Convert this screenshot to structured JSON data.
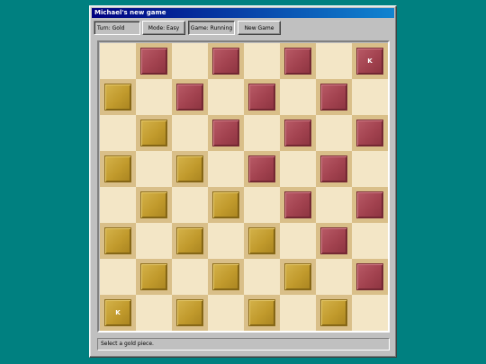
{
  "window": {
    "title": "Michael's new game"
  },
  "toolbar": {
    "turn": "Turn: Gold",
    "mode": "Mode: Easy",
    "game": "Game: Running",
    "new_game": "New Game"
  },
  "board": {
    "rows": 8,
    "cols": 8,
    "colors": {
      "light": "#f3e6c6",
      "dark": "#d9bf89",
      "red": "#a2424f",
      "gold": "#c19a2c"
    },
    "pieces": [
      {
        "row": 0,
        "col": 1,
        "color": "red",
        "king": false
      },
      {
        "row": 0,
        "col": 3,
        "color": "red",
        "king": false
      },
      {
        "row": 0,
        "col": 5,
        "color": "red",
        "king": false
      },
      {
        "row": 0,
        "col": 7,
        "color": "red",
        "king": true
      },
      {
        "row": 1,
        "col": 0,
        "color": "gold",
        "king": false
      },
      {
        "row": 1,
        "col": 2,
        "color": "red",
        "king": false
      },
      {
        "row": 1,
        "col": 4,
        "color": "red",
        "king": false
      },
      {
        "row": 1,
        "col": 6,
        "color": "red",
        "king": false
      },
      {
        "row": 2,
        "col": 1,
        "color": "gold",
        "king": false
      },
      {
        "row": 2,
        "col": 3,
        "color": "red",
        "king": false
      },
      {
        "row": 2,
        "col": 5,
        "color": "red",
        "king": false
      },
      {
        "row": 2,
        "col": 7,
        "color": "red",
        "king": false
      },
      {
        "row": 3,
        "col": 0,
        "color": "gold",
        "king": false
      },
      {
        "row": 3,
        "col": 2,
        "color": "gold",
        "king": false
      },
      {
        "row": 3,
        "col": 4,
        "color": "red",
        "king": false
      },
      {
        "row": 3,
        "col": 6,
        "color": "red",
        "king": false
      },
      {
        "row": 4,
        "col": 1,
        "color": "gold",
        "king": false
      },
      {
        "row": 4,
        "col": 3,
        "color": "gold",
        "king": false
      },
      {
        "row": 4,
        "col": 5,
        "color": "red",
        "king": false
      },
      {
        "row": 4,
        "col": 7,
        "color": "red",
        "king": false
      },
      {
        "row": 5,
        "col": 0,
        "color": "gold",
        "king": false
      },
      {
        "row": 5,
        "col": 2,
        "color": "gold",
        "king": false
      },
      {
        "row": 5,
        "col": 4,
        "color": "gold",
        "king": false
      },
      {
        "row": 5,
        "col": 6,
        "color": "red",
        "king": false
      },
      {
        "row": 6,
        "col": 1,
        "color": "gold",
        "king": false
      },
      {
        "row": 6,
        "col": 3,
        "color": "gold",
        "king": false
      },
      {
        "row": 6,
        "col": 5,
        "color": "gold",
        "king": false
      },
      {
        "row": 6,
        "col": 7,
        "color": "red",
        "king": false
      },
      {
        "row": 7,
        "col": 0,
        "color": "gold",
        "king": true
      },
      {
        "row": 7,
        "col": 2,
        "color": "gold",
        "king": false
      },
      {
        "row": 7,
        "col": 4,
        "color": "gold",
        "king": false
      },
      {
        "row": 7,
        "col": 6,
        "color": "gold",
        "king": false
      }
    ],
    "king_label": "K"
  },
  "status": {
    "message": "Select a gold piece."
  }
}
